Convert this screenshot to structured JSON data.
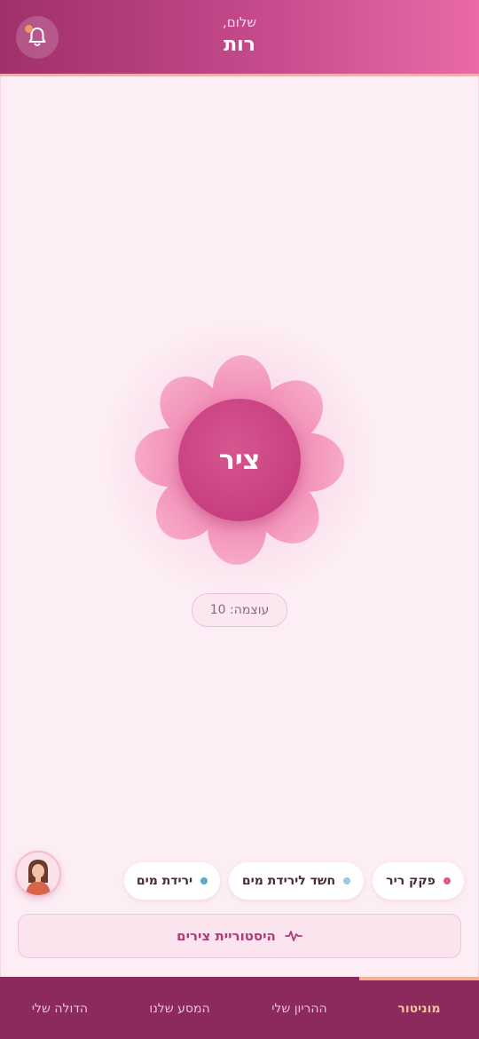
{
  "header": {
    "greeting": "שלום,",
    "user_name": "רות",
    "notifications_icon": "bell-icon"
  },
  "contraction_button": {
    "label": "ציר"
  },
  "intensity": {
    "label": "עוצמה: 10"
  },
  "status_chips": [
    {
      "label": "פקק ריר",
      "dot_color": "#e0568f"
    },
    {
      "label": "חשד לירידת מים",
      "dot_color": "#9cc8de"
    },
    {
      "label": "ירידת מים",
      "dot_color": "#5aa9c6"
    }
  ],
  "history_button": {
    "label": "היסטוריית צירים",
    "icon": "activity-pulse-icon"
  },
  "avatar": {
    "icon": "doula-avatar"
  },
  "bottom_nav": {
    "items": [
      {
        "label": "מוניטור",
        "active": true
      },
      {
        "label": "ההריון שלי",
        "active": false
      },
      {
        "label": "המסע שלנו",
        "active": false
      },
      {
        "label": "הדולה שלי",
        "active": false
      }
    ]
  },
  "colors": {
    "header_start": "#a0306a",
    "header_end": "#e96aa6",
    "accent": "#c83f80",
    "nav_background": "#8c2a5c",
    "nav_active": "#f6c29a",
    "background": "#fdeef5"
  }
}
